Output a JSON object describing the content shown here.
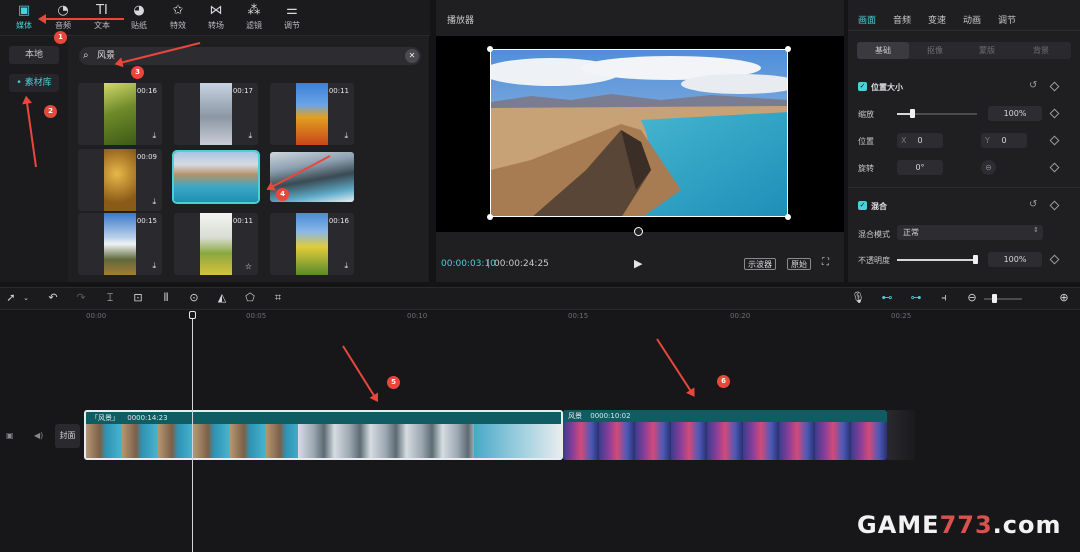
{
  "top_tabs": [
    {
      "label": "媒体",
      "icon": "media-icon",
      "active": true
    },
    {
      "label": "音频",
      "icon": "audio-icon"
    },
    {
      "label": "文本",
      "icon": "text-icon"
    },
    {
      "label": "贴纸",
      "icon": "sticker-icon"
    },
    {
      "label": "特效",
      "icon": "effects-icon"
    },
    {
      "label": "转场",
      "icon": "transition-icon"
    },
    {
      "label": "滤镜",
      "icon": "filter-icon"
    },
    {
      "label": "调节",
      "icon": "adjust-icon"
    }
  ],
  "left_nav": {
    "local": "本地",
    "library": "• 素材库"
  },
  "search": {
    "query": "风景"
  },
  "media_grid": [
    {
      "duration": "00:16"
    },
    {
      "duration": "00:17"
    },
    {
      "duration": "00:11"
    },
    {
      "duration": "00:09"
    },
    {
      "duration": ""
    },
    {
      "duration": ""
    },
    {
      "duration": "00:15"
    },
    {
      "duration": "00:11"
    },
    {
      "duration": "00:16"
    }
  ],
  "player": {
    "title": "播放器",
    "current_time": "00:00:03:10",
    "total_time": "00:00:24:25",
    "btn_waveform": "示波器",
    "btn_original": "原始"
  },
  "props": {
    "tabs": [
      "画面",
      "音频",
      "变速",
      "动画",
      "调节"
    ],
    "sub_tabs": [
      "基础",
      "抠像",
      "蒙版",
      "背景"
    ],
    "section_position": "位置大小",
    "scale_label": "缩放",
    "scale_value": "100%",
    "position_label": "位置",
    "pos_x_prefix": "X",
    "pos_x": "0",
    "pos_y_prefix": "Y",
    "pos_y": "0",
    "rotate_label": "旋转",
    "rotate_value": "0°",
    "section_blend": "混合",
    "blend_mode_label": "混合模式",
    "blend_mode_value": "正常",
    "opacity_label": "不透明度",
    "opacity_value": "100%"
  },
  "ruler": [
    "00:00",
    "00:05",
    "00:10",
    "00:15",
    "00:20",
    "00:25"
  ],
  "cover_label": "封面",
  "clips": [
    {
      "name": "「风景」",
      "duration": "0000:14:23"
    },
    {
      "name": "风景",
      "duration": "0000:10:02"
    }
  ],
  "annotations": [
    "1",
    "2",
    "3",
    "4",
    "5",
    "6"
  ],
  "watermark": {
    "a": "GAME",
    "b": "773",
    "c": ".com"
  },
  "colors": {
    "accent": "#4ad0d8",
    "annotation": "#e8473c",
    "clip_header": "#0f5c62"
  }
}
